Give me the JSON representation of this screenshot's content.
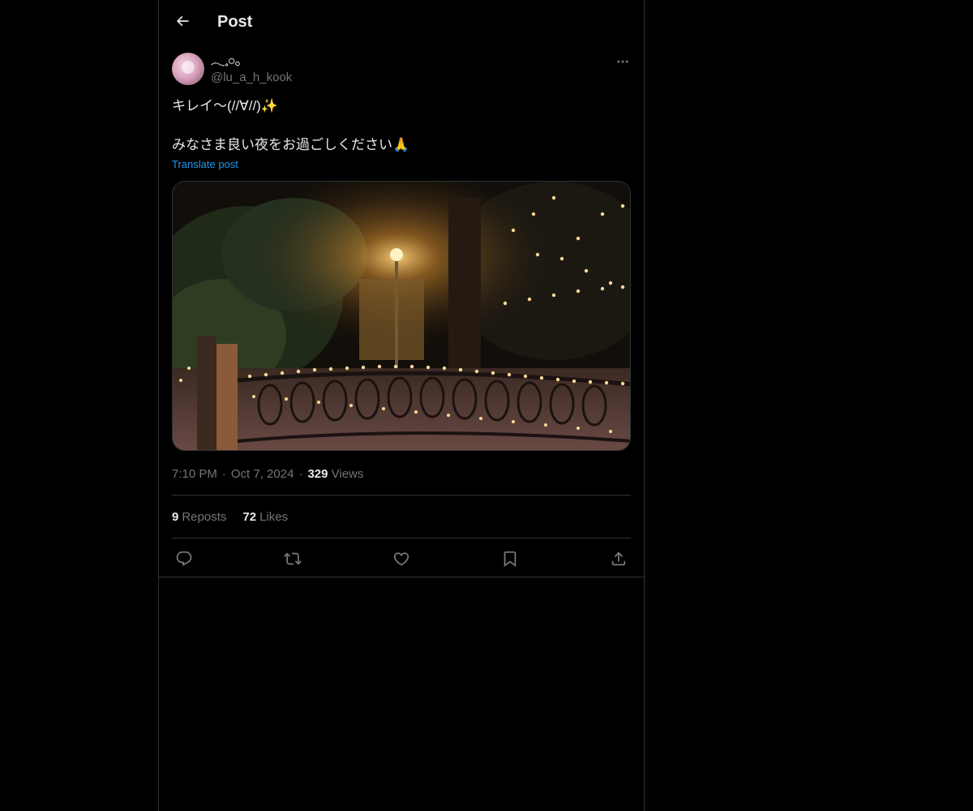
{
  "header": {
    "title": "Post",
    "back_icon": "arrow-left-icon"
  },
  "author": {
    "display_name": "𓂃𓈒𓏸𓂂",
    "handle": "@lu_a_h_kook",
    "more_icon": "more-horizontal-icon"
  },
  "post": {
    "text": "キレイ〜(//∀//)✨\n\nみなさま良い夜をお過ごしください🙏",
    "translate_label": "Translate post",
    "media_alt": "Night garden with string lights along an iron fence"
  },
  "meta": {
    "time": "7:10 PM",
    "separator": "·",
    "date": "Oct 7, 2024",
    "views_count": "329",
    "views_label": "Views"
  },
  "stats": {
    "reposts_count": "9",
    "reposts_label": "Reposts",
    "likes_count": "72",
    "likes_label": "Likes"
  },
  "actions": {
    "reply_icon": "reply-icon",
    "repost_icon": "repost-icon",
    "like_icon": "heart-icon",
    "bookmark_icon": "bookmark-icon",
    "share_icon": "share-icon"
  },
  "colors": {
    "background": "#000000",
    "text_primary": "#e7e9ea",
    "text_secondary": "#71767b",
    "link": "#1d9bf0",
    "border": "#2f3336"
  }
}
